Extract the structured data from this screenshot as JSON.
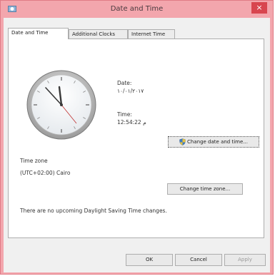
{
  "window": {
    "title": "Date and Time",
    "close_glyph": "×"
  },
  "tabs": [
    {
      "label": "Date and Time",
      "active": true
    },
    {
      "label": "Additional Clocks",
      "active": false
    },
    {
      "label": "Internet Time",
      "active": false
    }
  ],
  "datetime": {
    "date_label": "Date:",
    "date_value": "١٠/٠١/٢٠١٧",
    "time_label": "Time:",
    "time_value": "12:54:22 م",
    "change_button": "Change date and time..."
  },
  "timezone": {
    "label": "Time zone",
    "value": "(UTC+02:00) Cairo",
    "change_button": "Change time zone..."
  },
  "dst_message": "There are no upcoming Daylight Saving Time changes.",
  "footer": {
    "ok": "OK",
    "cancel": "Cancel",
    "apply": "Apply"
  },
  "icons": {
    "app": "clock-app-icon",
    "shield": "uac-shield-icon",
    "close": "close-icon"
  },
  "colors": {
    "titlebar": "#f3a6ad",
    "close_button": "#d8454f"
  }
}
